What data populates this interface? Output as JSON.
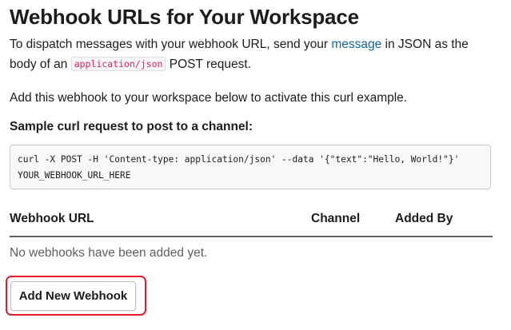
{
  "header": {
    "title": "Webhook URLs for Your Workspace"
  },
  "intro": {
    "text_before_link": "To dispatch messages with your webhook URL, send your ",
    "link_label": "message",
    "text_after_link": " in JSON as the body of an ",
    "code_snippet": "application/json",
    "text_end": " POST request."
  },
  "activate_note": "Add this webhook to your workspace below to activate this curl example.",
  "sample": {
    "label": "Sample curl request to post to a channel:",
    "code": "curl -X POST -H 'Content-type: application/json' --data '{\"text\":\"Hello, World!\"}' YOUR_WEBHOOK_URL_HERE"
  },
  "table": {
    "columns": [
      "Webhook URL",
      "Channel",
      "Added By"
    ],
    "rows": [],
    "empty_message": "No webhooks have been added yet."
  },
  "actions": {
    "add_button_label": "Add New Webhook",
    "highlight_color": "#e01e2a"
  },
  "colors": {
    "link": "#1264a3",
    "inline_code": "#e01e5a",
    "text": "#1d1c1d"
  }
}
